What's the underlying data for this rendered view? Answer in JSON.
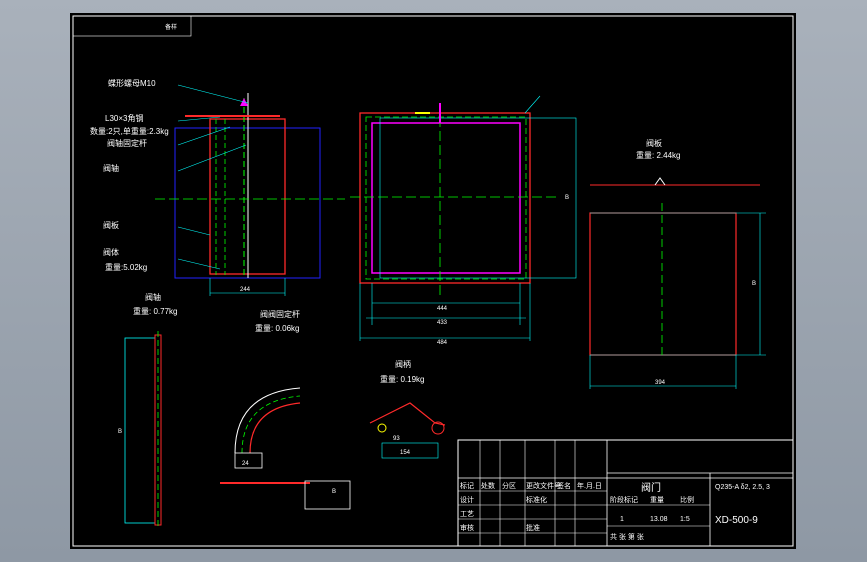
{
  "drawing": {
    "corner_tag": "备样",
    "labels": {
      "butterfly_nut": "蝶形螺母M10",
      "angle_steel": "L30×3角钢",
      "count_weight": "数量:2只,单重量:2.3kg",
      "shaft_bracket": "阀轴固定杆",
      "shaft": "阀轴",
      "plate": "阀板",
      "body": "阀体",
      "body_weight": "重量:5.02kg",
      "shaft_section_title": "阀轴",
      "shaft_weight": "重量: 0.77kg",
      "bracket_section_title": "阀阀固定杆",
      "bracket_weight": "重量: 0.06kg",
      "handle_title": "阀柄",
      "handle_weight": "重量: 0.19kg",
      "plate_section_title": "阀板",
      "plate_weight": "重量: 2.44kg"
    },
    "dims": {
      "d244": "244",
      "d444": "444",
      "d433": "433",
      "d484": "484",
      "d394": "394",
      "B": "B",
      "B2": "B",
      "B3": "B",
      "B4": "B",
      "d24": "24",
      "d154": "154",
      "d93": "93"
    }
  },
  "title_block": {
    "title": "阀门",
    "material": "Q235-A δ2, 2.5, 3",
    "drawing_no": "XD-500-9",
    "row_labels": [
      "标记",
      "设计",
      "工艺",
      "审核"
    ],
    "hdr": [
      "处数",
      "分区",
      "更改文件号",
      "签名",
      "年.月.日"
    ],
    "std_label": "标准化",
    "approve_label": "批准",
    "stage_label": "阶段标记",
    "weight_label": "重量",
    "scale_label": "比例",
    "qty_value": "1",
    "weight_value": "13.08",
    "scale_value": "1:5",
    "sheets": "共  张  第  张"
  }
}
